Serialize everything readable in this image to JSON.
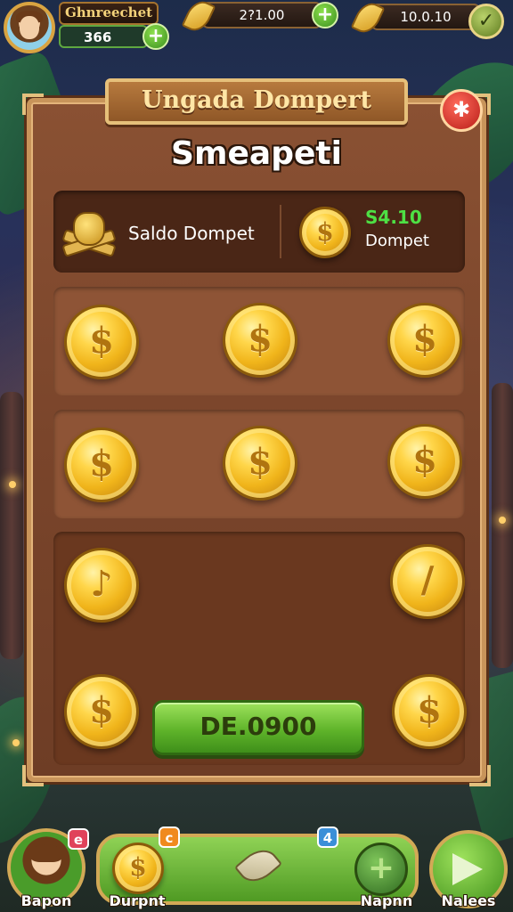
{
  "hud": {
    "player_name": "Ghnreechet",
    "player_score": "366",
    "resource_1": "2?1.00",
    "resource_2": "10.0.10",
    "plus_symbol": "+",
    "check_symbol": "✓"
  },
  "panel": {
    "title": "Ungada Dompert",
    "close_symbol": "✱",
    "subtitle": "Smeapeti",
    "balance": {
      "label": "Saldo Dompet",
      "value": "S4.10",
      "value_label": "Dompet"
    },
    "coin_symbol": "$",
    "coin_rows": [
      [
        "$",
        "$",
        "$"
      ],
      [
        "$",
        "$",
        "$"
      ],
      [
        "♪",
        "/",
        "$",
        "$"
      ]
    ],
    "deposit_button": "DE.0900"
  },
  "bottom_nav": {
    "items": [
      {
        "label": "Bapon",
        "icon": "avatar-icon",
        "badge": "e"
      },
      {
        "label": "Durpnt",
        "icon": "coin-icon",
        "badge": "c"
      },
      {
        "label": "",
        "icon": "leaf-icon"
      },
      {
        "label": "Napnn",
        "icon": "plus-icon",
        "badge": "4"
      },
      {
        "label": "Nalees",
        "icon": "forward-icon"
      }
    ]
  },
  "colors": {
    "panel_brown": "#7a452b",
    "accent_green": "#5fb42a",
    "balance_green": "#4ee044",
    "gold": "#f0b41a",
    "close_red": "#b81d18"
  }
}
